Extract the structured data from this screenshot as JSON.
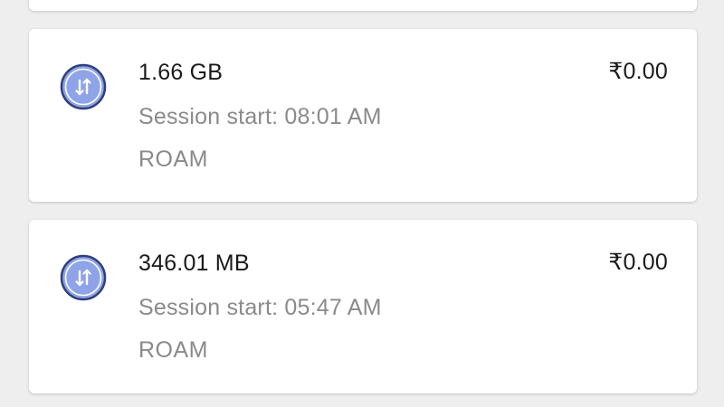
{
  "colors": {
    "background": "#eeeeee",
    "card": "#ffffff",
    "primary_text": "#1a1a1a",
    "secondary_text": "#8a8a8a",
    "icon_fill": "#8fa4e8",
    "icon_ring": "#2f3f7a"
  },
  "sessions": [
    {
      "icon": "data-transfer-icon",
      "data_used": "1.66 GB",
      "session_start": "Session start: 08:01 AM",
      "type": "ROAM",
      "cost": "₹0.00"
    },
    {
      "icon": "data-transfer-icon",
      "data_used": "346.01 MB",
      "session_start": "Session start: 05:47 AM",
      "type": "ROAM",
      "cost": "₹0.00"
    }
  ]
}
